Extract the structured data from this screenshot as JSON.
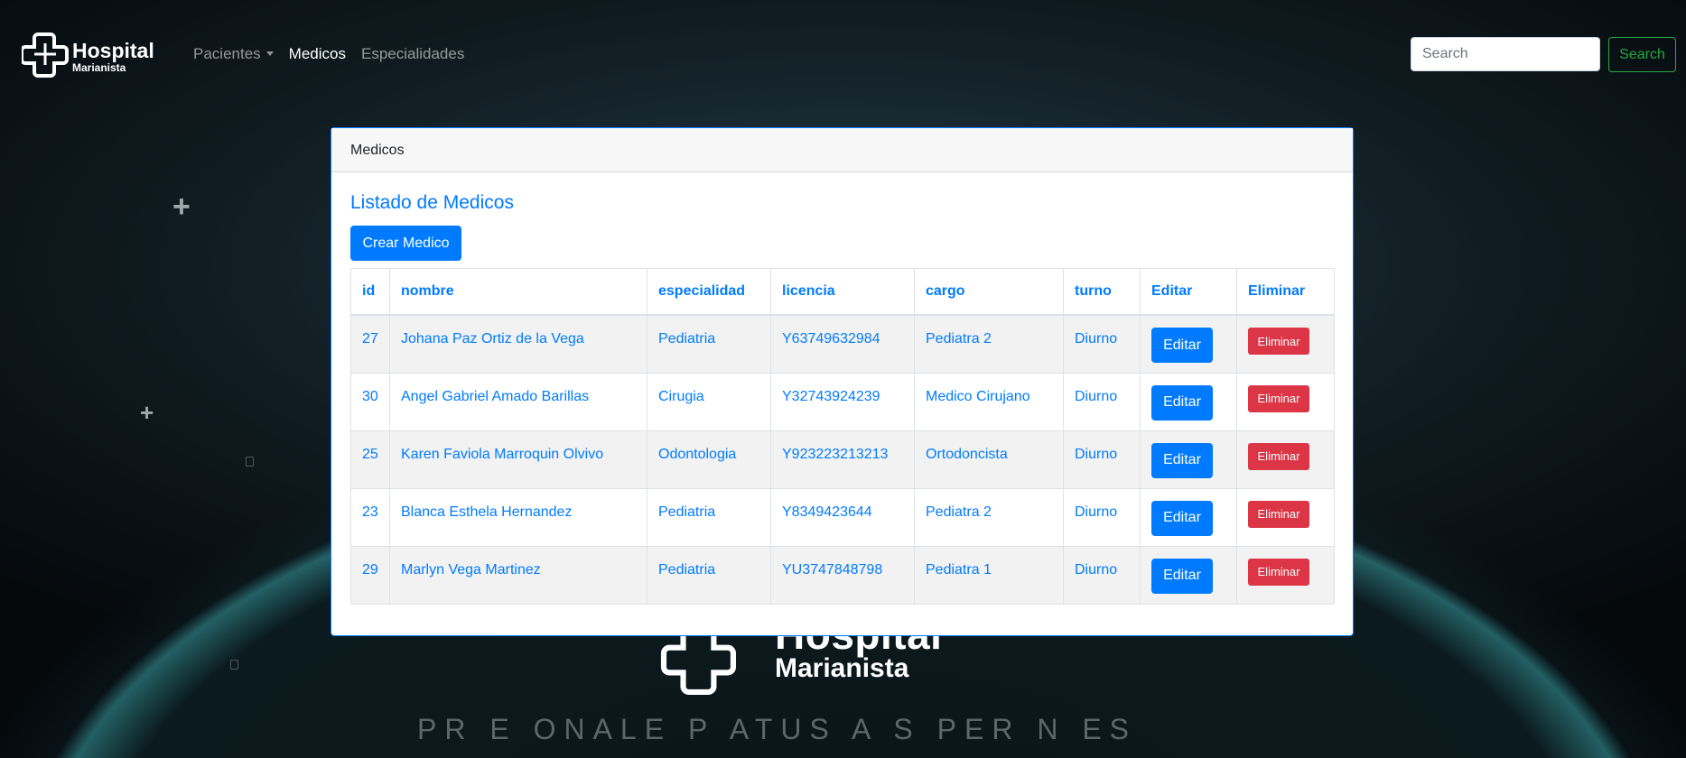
{
  "brand": {
    "line1": "Hospital",
    "line2": "Marianista"
  },
  "nav": {
    "links": [
      {
        "label": "Pacientes",
        "dropdown": true
      },
      {
        "label": "Medicos",
        "active": true
      },
      {
        "label": "Especialidades"
      }
    ]
  },
  "search": {
    "placeholder": "Search",
    "button": "Search"
  },
  "background": {
    "logo_line1": "Hospital",
    "logo_line2": "Marianista",
    "tagline": "PR      E   ONALE   P     ATUS    A    S PER       N    ES"
  },
  "card": {
    "header": "Medicos",
    "title": "Listado de Medicos",
    "create_button": "Crear Medico",
    "columns": [
      "id",
      "nombre",
      "especialidad",
      "licencia",
      "cargo",
      "turno",
      "Editar",
      "Eliminar"
    ],
    "rows": [
      {
        "id": "27",
        "nombre": "Johana Paz Ortiz de la Vega",
        "especialidad": "Pediatria",
        "licencia": "Y63749632984",
        "cargo": "Pediatra 2",
        "turno": "Diurno",
        "edit": "Editar",
        "delete": "Eliminar"
      },
      {
        "id": "30",
        "nombre": "Angel Gabriel Amado Barillas",
        "especialidad": "Cirugia",
        "licencia": "Y32743924239",
        "cargo": "Medico Cirujano",
        "turno": "Diurno",
        "edit": "Editar",
        "delete": "Eliminar"
      },
      {
        "id": "25",
        "nombre": "Karen Faviola Marroquin Olvivo",
        "especialidad": "Odontologia",
        "licencia": "Y923223213213",
        "cargo": "Ortodoncista",
        "turno": "Diurno",
        "edit": "Editar",
        "delete": "Eliminar"
      },
      {
        "id": "23",
        "nombre": "Blanca Esthela Hernandez",
        "especialidad": "Pediatria",
        "licencia": "Y8349423644",
        "cargo": "Pediatra 2",
        "turno": "Diurno",
        "edit": "Editar",
        "delete": "Eliminar"
      },
      {
        "id": "29",
        "nombre": "Marlyn Vega Martinez",
        "especialidad": "Pediatria",
        "licencia": "YU3747848798",
        "cargo": "Pediatra 1",
        "turno": "Diurno",
        "edit": "Editar",
        "delete": "Eliminar"
      }
    ]
  },
  "colors": {
    "primary": "#007bff",
    "danger": "#dc3545",
    "success": "#28a745"
  }
}
